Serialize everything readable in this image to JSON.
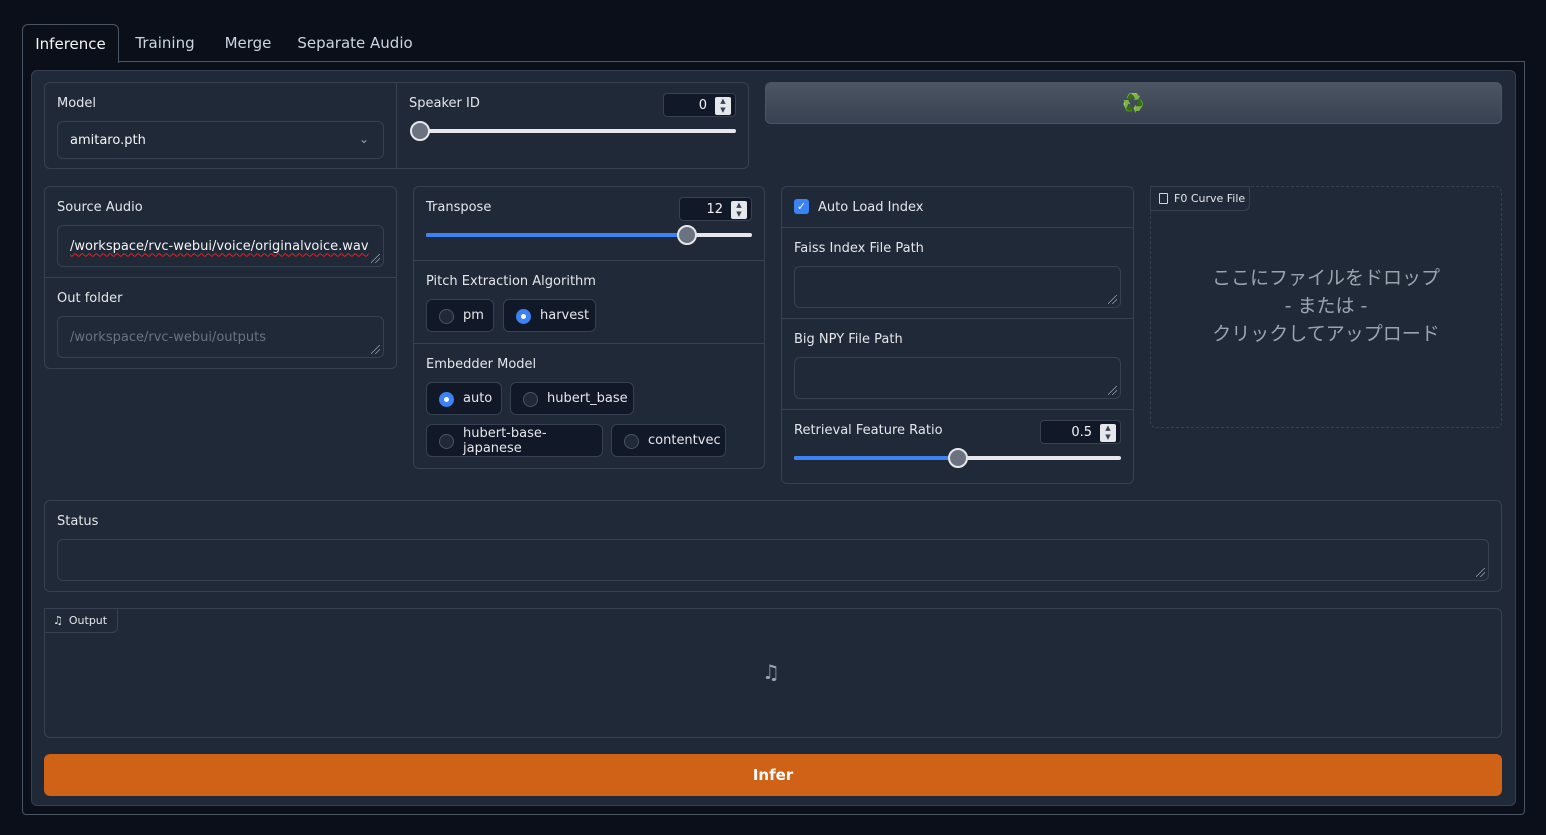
{
  "tabs": [
    "Inference",
    "Training",
    "Merge",
    "Separate Audio"
  ],
  "model": {
    "label": "Model",
    "value": "amitaro.pth"
  },
  "speaker": {
    "label": "Speaker ID",
    "value": "0",
    "fraction": 0.0
  },
  "refresh": {
    "icon": "recycle-icon",
    "glyph": "♻️"
  },
  "source_audio": {
    "label": "Source Audio",
    "value": "/workspace/rvc-webui/voice/originalvoice.wav"
  },
  "out_folder": {
    "label": "Out folder",
    "placeholder": "/workspace/rvc-webui/outputs"
  },
  "transpose": {
    "label": "Transpose",
    "value": "12",
    "fraction": 0.8
  },
  "pitch": {
    "label": "Pitch Extraction Algorithm",
    "options": [
      "pm",
      "harvest"
    ],
    "selected": "harvest"
  },
  "embedder": {
    "label": "Embedder Model",
    "options": [
      "auto",
      "hubert_base",
      "hubert-base-japanese",
      "contentvec"
    ],
    "selected": "auto"
  },
  "auto_load": {
    "label": "Auto Load Index",
    "checked": true
  },
  "faiss": {
    "label": "Faiss Index File Path"
  },
  "npy": {
    "label": "Big NPY File Path"
  },
  "ratio": {
    "label": "Retrieval Feature Ratio",
    "value": "0.5",
    "fraction": 0.5
  },
  "f0": {
    "label": "F0 Curve File",
    "drop_line1": "ここにファイルをドロップ",
    "drop_line2": "- または -",
    "drop_line3": "クリックしてアップロード"
  },
  "status": {
    "label": "Status"
  },
  "output": {
    "label": "Output"
  },
  "infer": {
    "label": "Infer"
  },
  "colors": {
    "accent": "#3b82f6",
    "primary_button": "#cf6217",
    "background": "#0b0f19",
    "panel": "#1f2937"
  }
}
